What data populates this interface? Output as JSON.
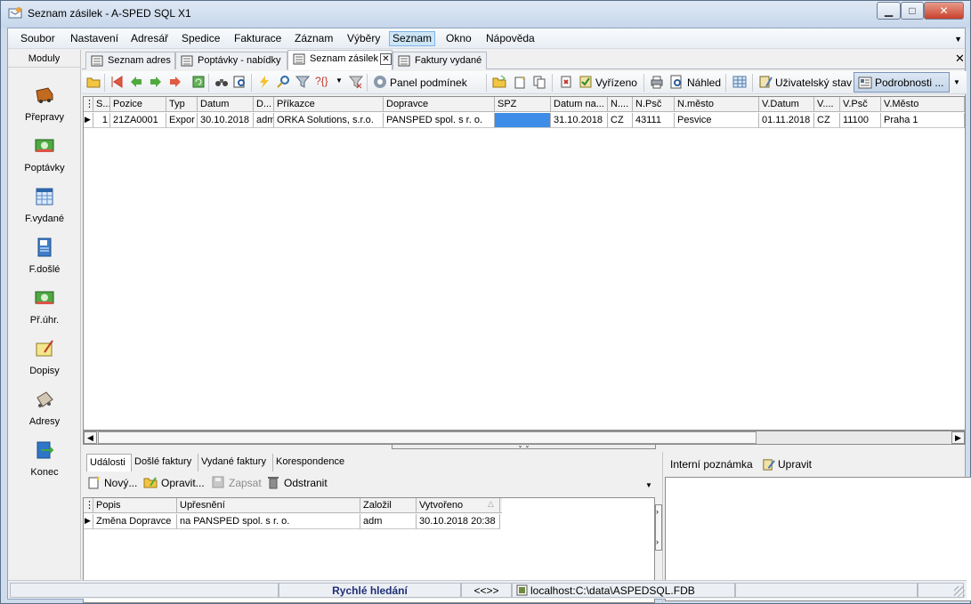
{
  "window": {
    "title": "Seznam zásilek - A-SPED SQL X1",
    "controls": [
      "minimize-icon",
      "maximize-icon",
      "close-icon"
    ]
  },
  "menu": {
    "items": [
      "Soubor",
      "Nastavení",
      "Adresář",
      "Spedice",
      "Fakturace",
      "Záznam",
      "Výběry",
      "Seznam",
      "Okno",
      "Nápověda"
    ],
    "active": "Seznam"
  },
  "sidebar": {
    "header": "Moduly",
    "modules": [
      {
        "label": "Přepravy",
        "icon": "truck-icon"
      },
      {
        "label": "Poptávky",
        "icon": "money-icon"
      },
      {
        "label": "F.vydané",
        "icon": "spreadsheet-icon"
      },
      {
        "label": "F.došlé",
        "icon": "book-icon"
      },
      {
        "label": "Př.úhr.",
        "icon": "money-icon"
      },
      {
        "label": "Dopisy",
        "icon": "letter-icon"
      },
      {
        "label": "Adresy",
        "icon": "rolodex-icon"
      },
      {
        "label": "Konec",
        "icon": "exit-icon"
      }
    ]
  },
  "tabs": [
    {
      "label": "Seznam adres"
    },
    {
      "label": "Poptávky - nabídky"
    },
    {
      "label": "Seznam zásilek",
      "selected": true
    },
    {
      "label": "Faktury vydané"
    }
  ],
  "toolbar": {
    "panel_label": "Panel podmínek",
    "done_label": "Vyřízeno",
    "preview_label": "Náhled",
    "user_state_label": "Uživatelský stav",
    "details_label": "Podrobnosti ..."
  },
  "main_grid": {
    "columns": [
      "S...",
      "Pozice",
      "Typ",
      "Datum",
      "D...",
      "Příkazce",
      "Dopravce",
      "SPZ",
      "Datum na...",
      "N....",
      "N.Psč",
      "N.město",
      "V.Datum",
      "V....",
      "V.Psč",
      "V.Město"
    ],
    "rows": [
      [
        "1",
        "21ZA0001",
        "Expor",
        "30.10.2018",
        "adm",
        "ORKA Solutions, s.r.o.",
        "PANSPED spol. s r. o.",
        "",
        "31.10.2018",
        "CZ",
        "43111",
        "Pesvice",
        "01.11.2018",
        "CZ",
        "11100",
        "Praha 1"
      ]
    ]
  },
  "bottom_tabs": [
    "Události",
    "Došlé faktury",
    "Vydané faktury",
    "Korespondence"
  ],
  "bottom_toolbar": {
    "new": "Nový...",
    "edit": "Opravit...",
    "save": "Zapsat",
    "delete": "Odstranit"
  },
  "events_grid": {
    "columns": [
      "Popis",
      "Upřesnění",
      "Založil",
      "Vytvořeno"
    ],
    "rows": [
      [
        "Změna Dopravce",
        "na PANSPED spol. s r. o.",
        "adm",
        "30.10.2018 20:38"
      ]
    ]
  },
  "note_panel": {
    "title": "Interní poznámka",
    "edit": "Upravit"
  },
  "statusbar": {
    "quick_search": "Rychlé hledání",
    "nav": "<<>>",
    "db": "localhost:C:\\data\\ASPEDSQL.FDB"
  }
}
